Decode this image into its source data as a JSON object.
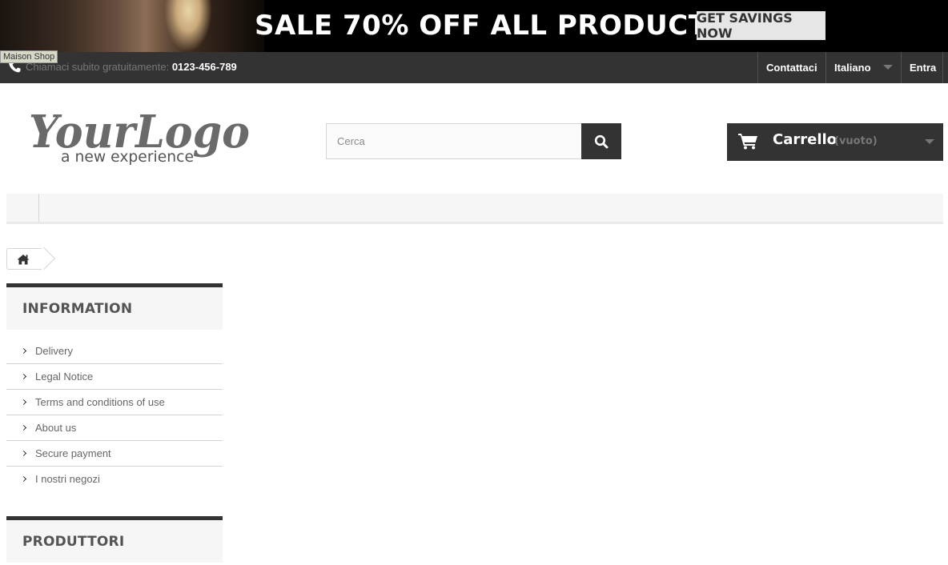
{
  "banner": {
    "headline": "SALE 70% OFF ALL PRODUCTS",
    "cta_label": "GET SAVINGS NOW"
  },
  "tooltip": "Maison Shop",
  "navbar": {
    "call_prefix": "Chiamaci subito gratuitamente:",
    "phone": "0123-456-789",
    "contact_label": "Contattaci",
    "language_label": "Italiano",
    "login_label": "Entra"
  },
  "header": {
    "logo_text": "YourLogo",
    "logo_tagline": "a new experience",
    "search_placeholder": "Cerca",
    "cart_label": "Carrello",
    "cart_status": "(vuoto)"
  },
  "sidebar": {
    "information": {
      "title": "INFORMATION",
      "items": [
        {
          "label": "Delivery"
        },
        {
          "label": "Legal Notice"
        },
        {
          "label": "Terms and conditions of use"
        },
        {
          "label": "About us"
        },
        {
          "label": "Secure payment"
        },
        {
          "label": "I nostri negozi"
        }
      ]
    },
    "manufacturers": {
      "title": "PRODUTTORI"
    }
  }
}
